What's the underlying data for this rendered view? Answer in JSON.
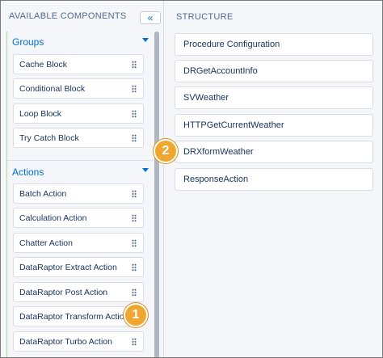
{
  "left_panel": {
    "title": "AVAILABLE COMPONENTS",
    "collapse_label": "«"
  },
  "groups": {
    "label": "Groups",
    "items": [
      "Cache Block",
      "Conditional Block",
      "Loop Block",
      "Try Catch Block"
    ]
  },
  "actions": {
    "label": "Actions",
    "items": [
      "Batch Action",
      "Calculation Action",
      "Chatter Action",
      "DataRaptor Extract Action",
      "DataRaptor Post Action",
      "DataRaptor Transform Action",
      "DataRaptor Turbo Action"
    ]
  },
  "structure": {
    "title": "STRUCTURE",
    "items": [
      "Procedure Configuration",
      "DRGetAccountInfo",
      "SVWeather",
      "HTTPGetCurrentWeather",
      "DRXformWeather",
      "ResponseAction"
    ]
  },
  "callouts": {
    "one": "1",
    "two": "2"
  },
  "colors": {
    "accent": "#0070d2",
    "callout": "#f0a72f",
    "text": "#16325c",
    "muted": "#54698d"
  }
}
